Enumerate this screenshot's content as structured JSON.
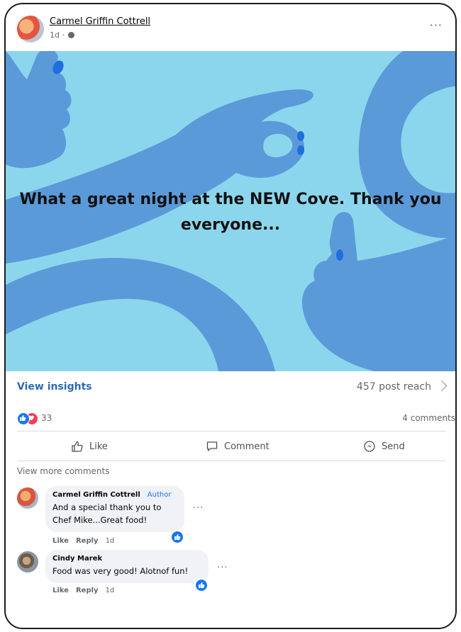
{
  "post": {
    "author": "Carmel Griffin Cottrell",
    "time": "1d ·",
    "more_label": "···",
    "image_text": "What a great night at the NEW Cove. Thank you everyone..."
  },
  "insights": {
    "link": "View insights",
    "reach": "457 post reach"
  },
  "reactions": {
    "count": "33",
    "comments": "4 comments"
  },
  "actions": {
    "like": "Like",
    "comment": "Comment",
    "send": "Send"
  },
  "view_more_comments": "View more comments",
  "comments": [
    {
      "name": "Carmel Griffin Cottrell",
      "badge": "Author",
      "text_line1": "And a special thank you to",
      "text_line2": "Chef Mike...Great food!",
      "like": "Like",
      "reply": "Reply",
      "time": "1d"
    },
    {
      "name": "Cindy Marek",
      "text_line1": "Food was very good! Alotnof fun!",
      "like": "Like",
      "reply": "Reply",
      "time": "1d"
    }
  ],
  "colors": {
    "image_bg": "#8cd6ed",
    "arm_blue": "#5b9ad9",
    "nail_blue": "#1f6ee0",
    "link_blue": "#2d6ab5",
    "like_blue": "#1877f2",
    "love_red": "#f33e58"
  },
  "icons": [
    "globe-icon",
    "more-icon",
    "chevron-right-icon",
    "like-reaction-icon",
    "love-reaction-icon",
    "thumbs-up-icon",
    "comment-icon",
    "messenger-send-icon"
  ]
}
